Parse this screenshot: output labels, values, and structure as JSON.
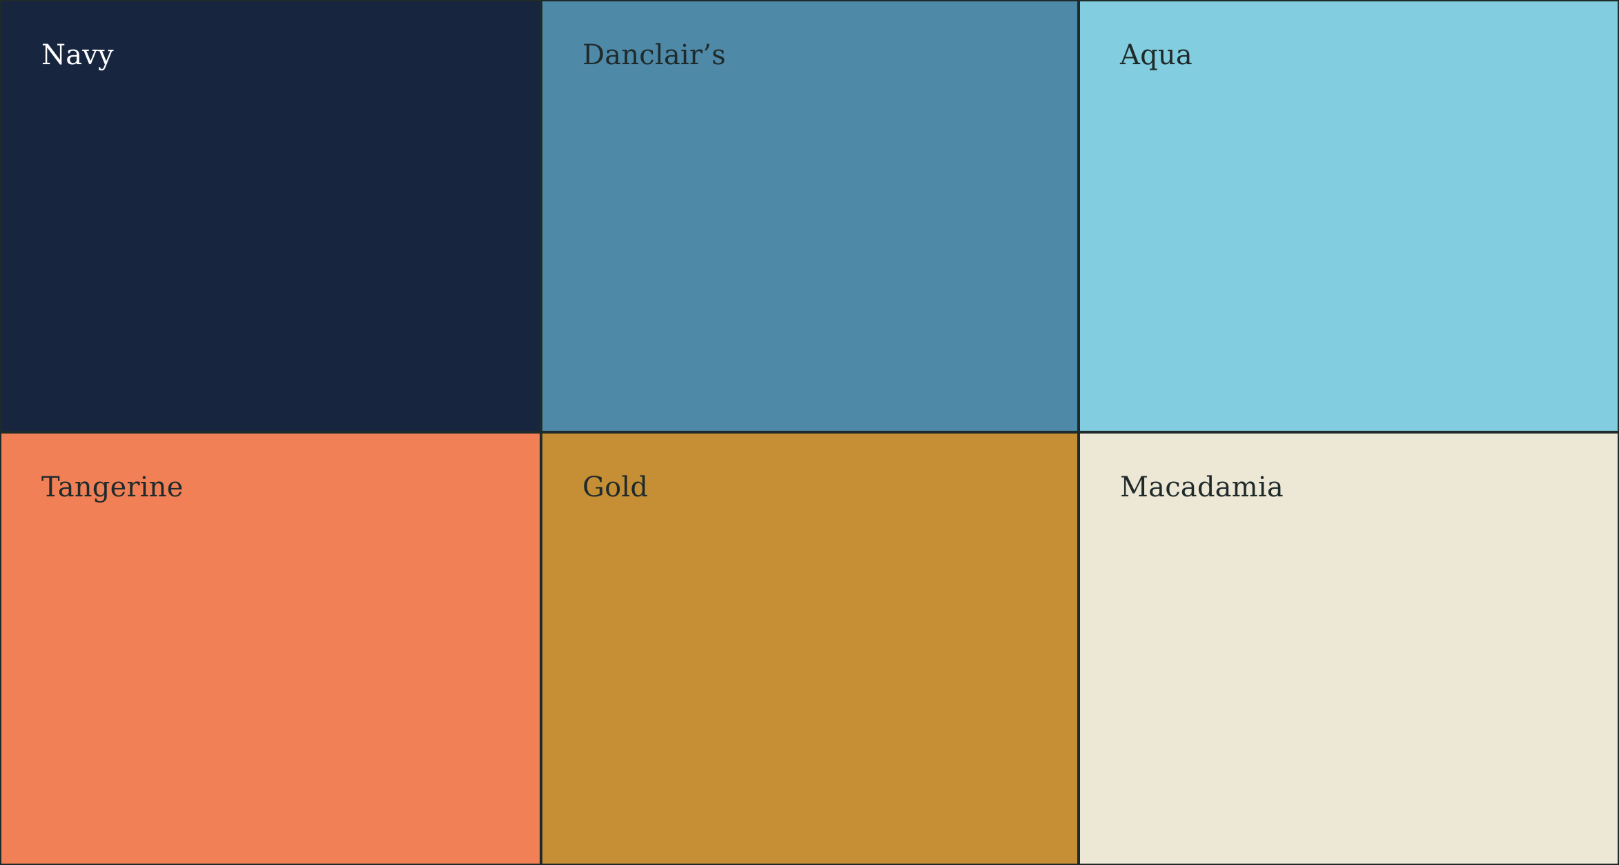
{
  "swatches": [
    {
      "name": "Navy",
      "color": "#17253f",
      "text_color": "#ffffff"
    },
    {
      "name": "Danclair’s",
      "color": "#4f89a8",
      "text_color": "#1f2b2b"
    },
    {
      "name": "Aqua",
      "color": "#82cddf",
      "text_color": "#1f2b2b"
    },
    {
      "name": "Tangerine",
      "color": "#f18056",
      "text_color": "#1f2b2b"
    },
    {
      "name": "Gold",
      "color": "#c78f35",
      "text_color": "#1f2b2b"
    },
    {
      "name": "Macadamia",
      "color": "#ede7d5",
      "text_color": "#1f2b2b"
    }
  ]
}
